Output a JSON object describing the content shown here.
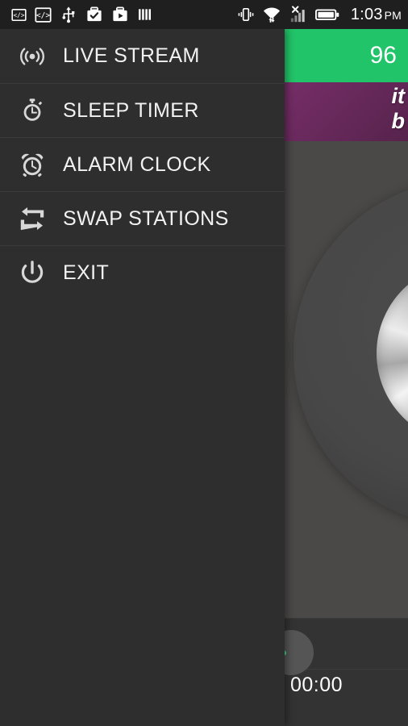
{
  "status_bar": {
    "icons_left": [
      "code-window-icon",
      "code-window-icon-2",
      "usb-icon",
      "work-check-icon",
      "work-play-icon",
      "bars-icon"
    ],
    "icons_right": [
      "vibrate-icon",
      "wifi-transfer-icon",
      "signal-no-service-icon",
      "battery-icon"
    ],
    "time": "1:03",
    "ampm": "PM"
  },
  "app_bar": {
    "menu_icon": "hamburger-icon",
    "station_name": "96"
  },
  "banner": {
    "photo_alt": "host-photo",
    "artwork_text": "it\nb"
  },
  "player": {
    "knob_icon": "rotary-volume-knob",
    "play_button_icon": "play-button",
    "elapsed_time": "00:00"
  },
  "drawer": {
    "items": [
      {
        "label": "LIVE STREAM",
        "icon": "broadcast-icon"
      },
      {
        "label": "SLEEP TIMER",
        "icon": "stopwatch-icon"
      },
      {
        "label": "ALARM CLOCK",
        "icon": "alarm-clock-icon"
      },
      {
        "label": "SWAP STATIONS",
        "icon": "swap-icon"
      },
      {
        "label": "EXIT",
        "icon": "power-icon"
      }
    ]
  },
  "colors": {
    "accent_green": "#22c469",
    "drawer_bg": "#2e2e2e",
    "player_bg": "#4a4947",
    "status_bg": "#1f1f1f",
    "artwork_purple": "#7a2f6b",
    "play_dot_green": "#3ddc8a"
  }
}
